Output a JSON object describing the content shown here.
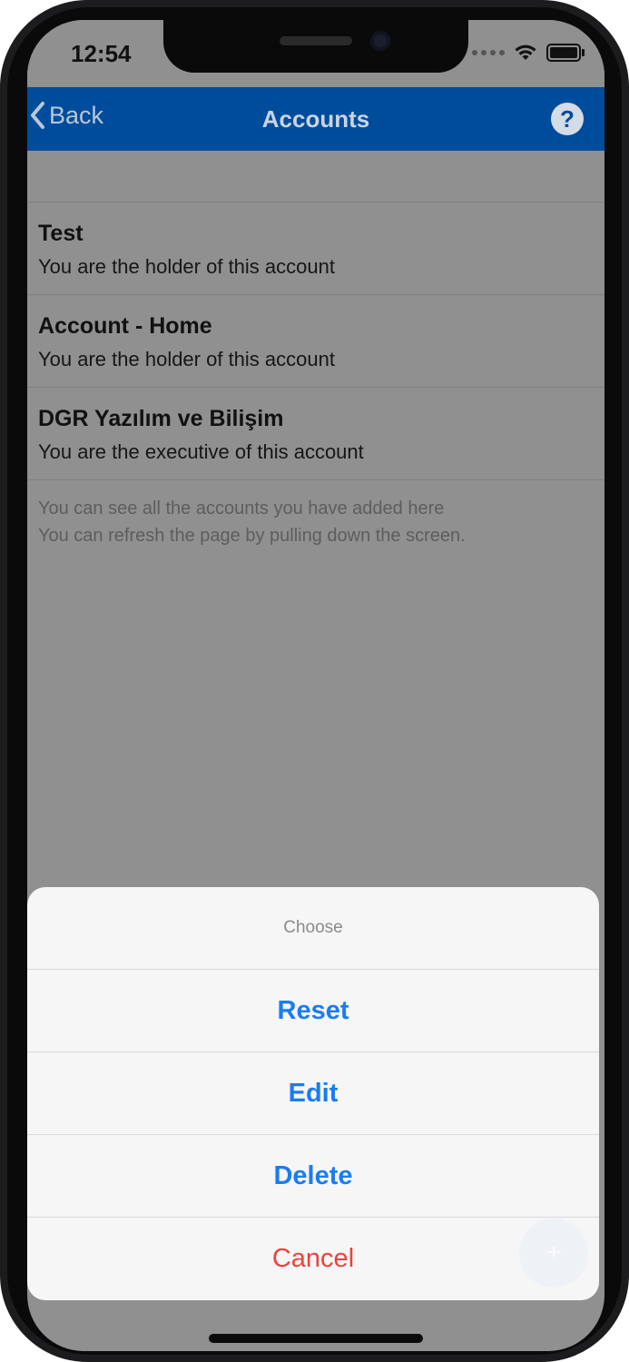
{
  "status_bar": {
    "time": "12:54",
    "icons": [
      "signal-icon",
      "wifi-icon",
      "battery-icon"
    ]
  },
  "nav": {
    "back_label": "Back",
    "title": "Accounts",
    "help_icon": "question-circle-icon",
    "color": "#004c9c"
  },
  "accounts": [
    {
      "name": "Test",
      "role": "You are the holder of this account"
    },
    {
      "name": "Account - Home",
      "role": "You are the holder of this account"
    },
    {
      "name": "DGR Yazılım ve Bilişim",
      "role": "You are the executive of this account"
    }
  ],
  "footer": {
    "line1": "You can see all the accounts you have added here",
    "line2": "You can refresh the page by pulling down the screen."
  },
  "action_sheet": {
    "title": "Choose",
    "buttons": [
      {
        "label": "Reset"
      },
      {
        "label": "Edit"
      },
      {
        "label": "Delete"
      }
    ],
    "cancel_label": "Cancel",
    "accent_color": "#1a7cf2",
    "cancel_color": "#e8443a"
  },
  "fab": {
    "icon": "plus-icon",
    "label": "+"
  }
}
